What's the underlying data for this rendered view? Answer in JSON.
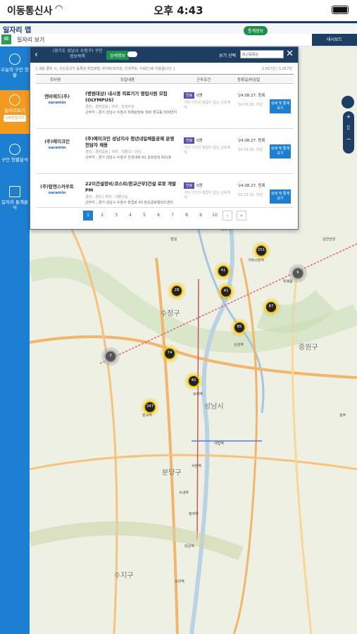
{
  "status_bar": {
    "carrier": "이동통신사",
    "time": "오후 4:43"
  },
  "app_bar": {
    "title": "일자리 맵"
  },
  "toolbar": {
    "menu_icon": "≡",
    "view_label": "일자리 보기",
    "top_pill": "통계정보",
    "dashboard": "대시보드"
  },
  "sidebar": {
    "items": [
      {
        "label": "오늘의 구인 현황",
        "active": false
      },
      {
        "label": "일자리보기",
        "badge": "내주변일자리",
        "active": true
      },
      {
        "label": "구인 현황분석",
        "active": false
      },
      {
        "label": "일자리 통계분석",
        "active": false
      }
    ]
  },
  "panel": {
    "region": "(경기도 성남시 수정구) 구인정보목록",
    "detail_button": "상세정보",
    "view_label": "보기 선택",
    "view_select": "최근등록순",
    "info_text": "[ 내용 클릭 시, 구인공고가 등록된 취업포털 사이트(워크넷, 인크루트, 사람인)로 이동합니다. ]",
    "count": "1,017건 / 1,017건",
    "headers": [
      "회사명",
      "모집내용",
      "근무조건",
      "등록일/마감일"
    ],
    "rows": [
      {
        "company": "엔비에드(주)",
        "source": "saramin",
        "title": "(병원대상) 내시경 의료기기 영업사원 모집 (OLYMPUS)",
        "meta": "경력 : 경력없음 | 학력 : 학력무관",
        "location": "근무지 : 경기 성남시 수정구 위례광장로 300 창곡동 509번지",
        "pay_tag": "연봉",
        "pay": "0원",
        "conditions": "기타 기간의 정함이 없는 근로계약",
        "registered": "'24.08.27. 등록",
        "deadline": "'24.09.26. 마감",
        "apply": "상세 및 통계보기"
      },
      {
        "company": "(주)에이크인",
        "source": "saramin",
        "title": "(주)에이크인 성남지사 청년내일채움공제 운영 전담자 채용",
        "meta": "경력 : 경력없음 | 학력 : 대졸(2~3년)",
        "location": "근무지 : 경기 성남시 수정구 산성대로 91 성호빌딩 601호",
        "pay_tag": "연봉",
        "pay": "0원",
        "conditions": "기타 기간의 정함이 없는 근로계약",
        "registered": "'24.08.27. 등록",
        "deadline": "'24.09.26. 마감",
        "apply": "상세 및 통계보기"
      },
      {
        "company": "(주)탑엔스카우트",
        "source": "saramin",
        "title": "22이건설장비/코스피/판교근무]건설 로봇 개발 PM",
        "meta": "경력 : 경력 | 학력 : 대졸이상",
        "location": "근무지 : 경기 성남시 수정구 창업로 43 판교글로벌비즈센터",
        "pay_tag": "연봉",
        "pay": "0원",
        "conditions": "기타 기간의 정함이 없는 근로계약",
        "registered": "'24.08.27. 등록",
        "deadline": "'32.12.31. 마감",
        "apply": "상세 및 통계보기"
      }
    ],
    "pages": [
      "1",
      "2",
      "3",
      "4",
      "5",
      "6",
      "7",
      "8",
      "9",
      "10"
    ],
    "next": "›",
    "last": "»"
  },
  "map": {
    "clusters": [
      {
        "label": "251",
        "style": "yellow"
      },
      {
        "label": "41",
        "style": "yellow"
      },
      {
        "label": "28",
        "style": "yellow"
      },
      {
        "label": "41",
        "style": "yellow"
      },
      {
        "label": "6",
        "style": "gray"
      },
      {
        "label": "87",
        "style": "yellow"
      },
      {
        "label": "85",
        "style": "yellow"
      },
      {
        "label": "74",
        "style": "yellow"
      },
      {
        "label": "2",
        "style": "gray"
      },
      {
        "label": "40",
        "style": "yellow"
      },
      {
        "label": "347",
        "style": "yellow"
      }
    ],
    "districts": [
      "수정구",
      "중원구",
      "성남시",
      "분당구",
      "수지구"
    ],
    "places": [
      "송파역",
      "잠실",
      "가락시장역",
      "복정역",
      "위례동",
      "산성역",
      "모란역",
      "야탑역",
      "판교역",
      "서현역",
      "수내역",
      "정자역",
      "미금역",
      "오리역",
      "남한산성",
      "광주"
    ]
  }
}
